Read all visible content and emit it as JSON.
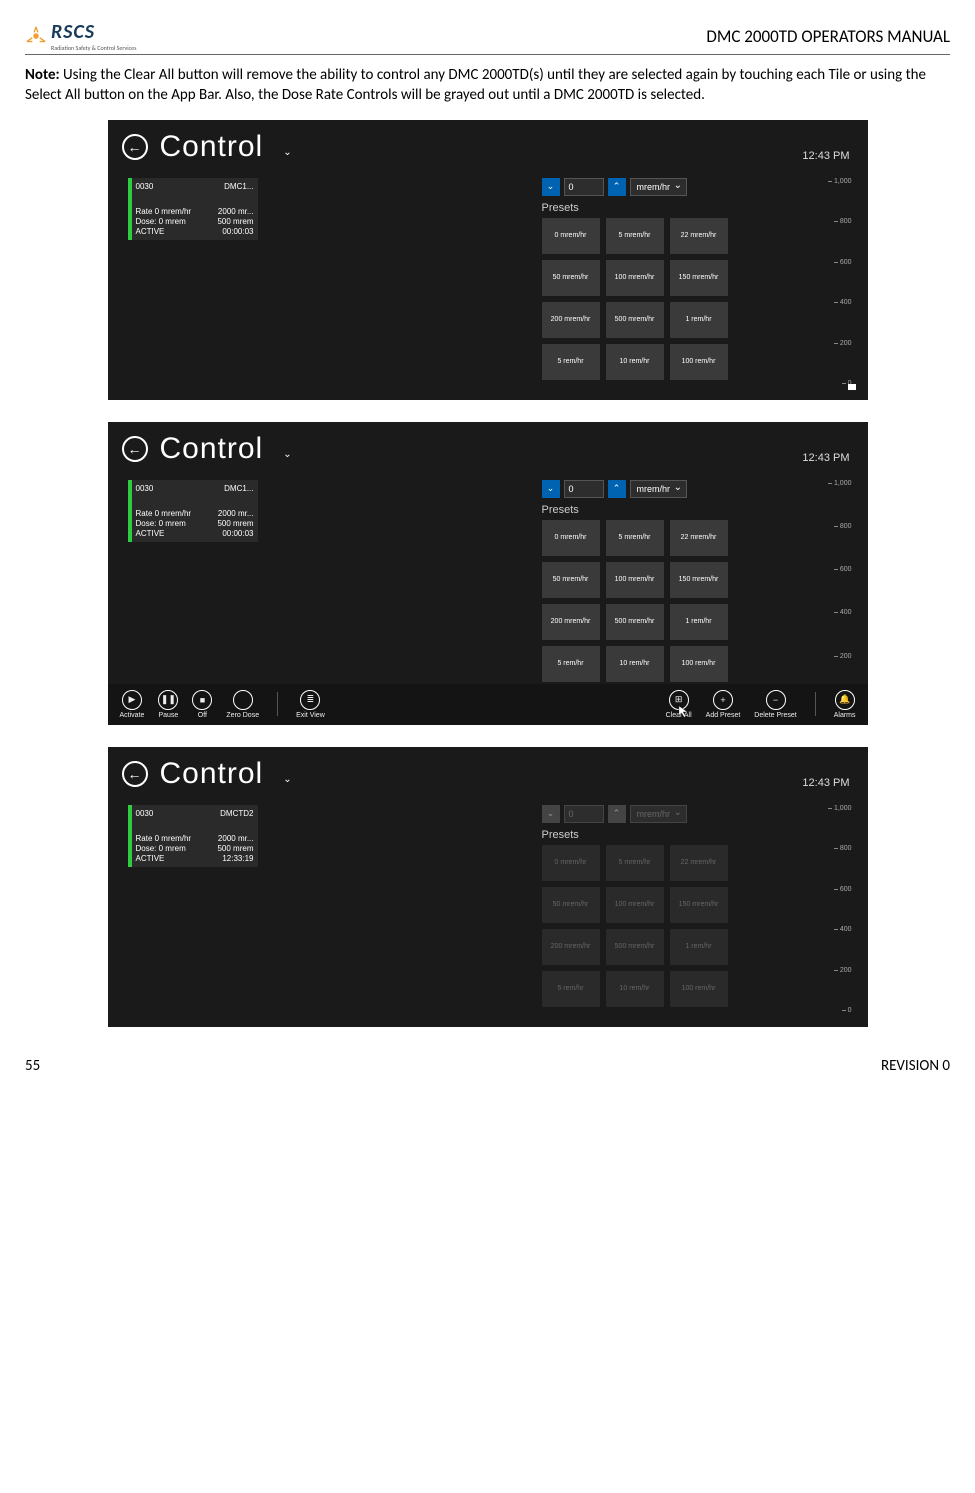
{
  "header": {
    "logo_text": "RSCS",
    "logo_sub": "Radiation Safety & Control Services",
    "manual_title": "DMC 2000TD OPERATORS MANUAL"
  },
  "note": {
    "label": "Note:",
    "text": " Using the Clear All button will remove the ability to control any DMC 2000TD(s) until they are selected again by touching each Tile or using the Select All button on the App Bar. Also, the Dose Rate Controls will be grayed out until a DMC 2000TD is selected."
  },
  "screen": {
    "title": "Control",
    "clock": "12:43 PM",
    "stepper_value": "0",
    "unit": "mrem/hr",
    "presets_label": "Presets",
    "presets": [
      "0 mrem/hr",
      "5 mrem/hr",
      "22 mrem/hr",
      "50 mrem/hr",
      "100 mrem/hr",
      "150 mrem/hr",
      "200 mrem/hr",
      "500 mrem/hr",
      "1 rem/hr",
      "5 rem/hr",
      "10 rem/hr",
      "100 rem/hr"
    ],
    "scale": [
      "1,000",
      "800",
      "600",
      "400",
      "200",
      "0"
    ]
  },
  "tile1": {
    "id": "0030",
    "name": "DMC1...",
    "r1a": "Rate 0 mrem/hr",
    "r1b": "2000 mr...",
    "r2a": "Dose: 0 mrem",
    "r2b": "500 mrem",
    "r3a": "ACTIVE",
    "r3b": "00:00:03"
  },
  "tile2": {
    "id": "0030",
    "name": "DMC1...",
    "r1a": "Rate 0 mrem/hr",
    "r1b": "2000 mr...",
    "r2a": "Dose: 0 mrem",
    "r2b": "500 mrem",
    "r3a": "ACTIVE",
    "r3b": "00:00:03"
  },
  "tile3": {
    "id": "0030",
    "name": "DMCTD2",
    "r1a": "Rate 0 mrem/hr",
    "r1b": "2000 mr...",
    "r2a": "Dose: 0 mrem",
    "r2b": "500 mrem",
    "r3a": "ACTIVE",
    "r3b": "12:33:19"
  },
  "appbar": {
    "activate": "Activate",
    "pause": "Pause",
    "off": "Off",
    "zero": "Zero Dose",
    "exit": "Exit View",
    "clear": "Clear All",
    "add": "Add Preset",
    "delete": "Delete Preset",
    "alarms": "Alarms"
  },
  "footer": {
    "page": "55",
    "revision": "REVISION 0"
  }
}
